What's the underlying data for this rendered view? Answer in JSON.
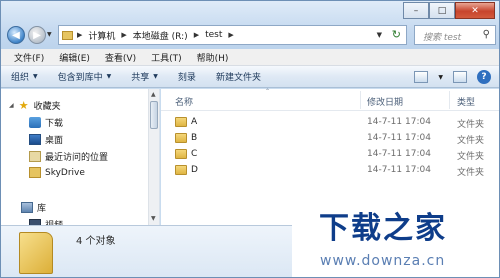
{
  "address": {
    "crumbs": [
      "计算机",
      "本地磁盘 (R:)",
      "test"
    ]
  },
  "search": {
    "placeholder": "搜索 test"
  },
  "menu": [
    "文件(F)",
    "编辑(E)",
    "查看(V)",
    "工具(T)",
    "帮助(H)"
  ],
  "toolbar": {
    "organize": "组织",
    "include": "包含到库中",
    "share": "共享",
    "burn": "刻录",
    "new_folder": "新建文件夹"
  },
  "nav": {
    "favorites": "收藏夹",
    "downloads": "下载",
    "desktop": "桌面",
    "recent": "最近访问的位置",
    "skydrive": "SkyDrive",
    "library": "库",
    "videos": "视频"
  },
  "columns": {
    "name": "名称",
    "date": "修改日期",
    "type": "类型"
  },
  "files": [
    {
      "name": "A",
      "date": "14-7-11 17:04",
      "type": "文件夹"
    },
    {
      "name": "B",
      "date": "14-7-11 17:04",
      "type": "文件夹"
    },
    {
      "name": "C",
      "date": "14-7-11 17:04",
      "type": "文件夹"
    },
    {
      "name": "D",
      "date": "14-7-11 17:04",
      "type": "文件夹"
    }
  ],
  "status": {
    "count": "4 个对象"
  },
  "watermark": {
    "title": "下载之家",
    "url": "www.downza.cn"
  }
}
